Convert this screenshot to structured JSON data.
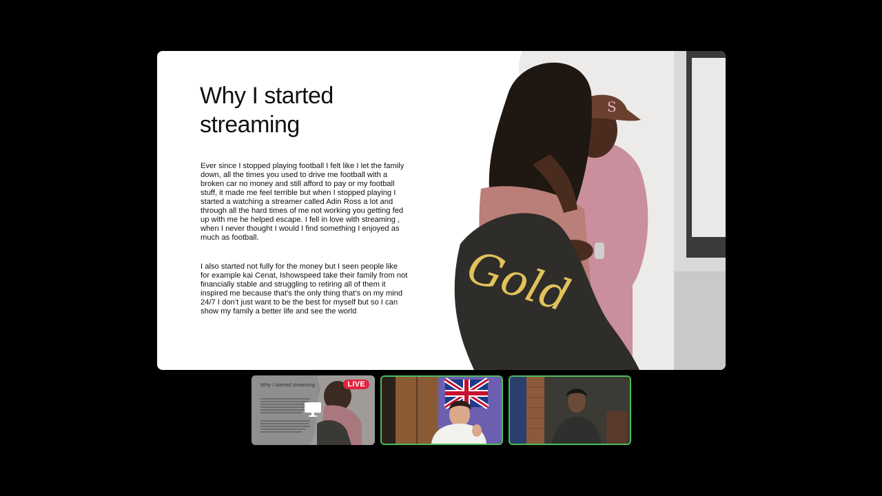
{
  "slide": {
    "title": "Why I started streaming",
    "paragraph_1": "Ever since I stopped playing football I felt like I let the family down, all the times you used to drive me football with a broken car no money and still afford to pay or my football stuff, it made me feel terrible but when I stopped playing I started a watching a streamer called Adin Ross a lot and through all the hard times of me not working you getting fed up with me he helped escape. I fell in love with streaming , when I never thought I would I find something I enjoyed as much as football.",
    "paragraph_2": "I also started not fully for the money but I seen people like for example kai Cenat, Ishowspeed take their family from not financially stable and struggling to retiring all of them it inspired me because that’s the only thing that’s on my mind 24/7 I don’t just want to be the best for myself but so I can show my family a better life and see the world",
    "image_caption_art": "Gold"
  },
  "participants": [
    {
      "name": "screen-share",
      "mini_title": "Why I started streaming",
      "badge": "LIVE",
      "icon": "screen-share-icon"
    },
    {
      "name": "camera-1",
      "icon": "video-feed"
    },
    {
      "name": "camera-2",
      "icon": "video-feed"
    }
  ],
  "colors": {
    "background": "#000000",
    "slide": "#ffffff",
    "active_border": "#4ebd5a",
    "live_badge": "#e0243c"
  }
}
